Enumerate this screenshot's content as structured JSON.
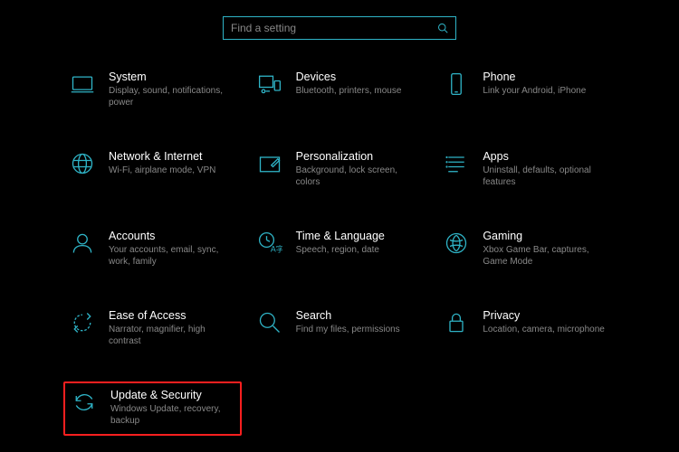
{
  "search": {
    "placeholder": "Find a setting"
  },
  "tiles": [
    {
      "id": "system",
      "title": "System",
      "sub": "Display, sound, notifications, power"
    },
    {
      "id": "devices",
      "title": "Devices",
      "sub": "Bluetooth, printers, mouse"
    },
    {
      "id": "phone",
      "title": "Phone",
      "sub": "Link your Android, iPhone"
    },
    {
      "id": "network",
      "title": "Network & Internet",
      "sub": "Wi-Fi, airplane mode, VPN"
    },
    {
      "id": "personalization",
      "title": "Personalization",
      "sub": "Background, lock screen, colors"
    },
    {
      "id": "apps",
      "title": "Apps",
      "sub": "Uninstall, defaults, optional features"
    },
    {
      "id": "accounts",
      "title": "Accounts",
      "sub": "Your accounts, email, sync, work, family"
    },
    {
      "id": "time-language",
      "title": "Time & Language",
      "sub": "Speech, region, date"
    },
    {
      "id": "gaming",
      "title": "Gaming",
      "sub": "Xbox Game Bar, captures, Game Mode"
    },
    {
      "id": "ease-of-access",
      "title": "Ease of Access",
      "sub": "Narrator, magnifier, high contrast"
    },
    {
      "id": "search",
      "title": "Search",
      "sub": "Find my files, permissions"
    },
    {
      "id": "privacy",
      "title": "Privacy",
      "sub": "Location, camera, microphone"
    },
    {
      "id": "update-security",
      "title": "Update & Security",
      "sub": "Windows Update, recovery, backup",
      "highlight": true
    }
  ]
}
